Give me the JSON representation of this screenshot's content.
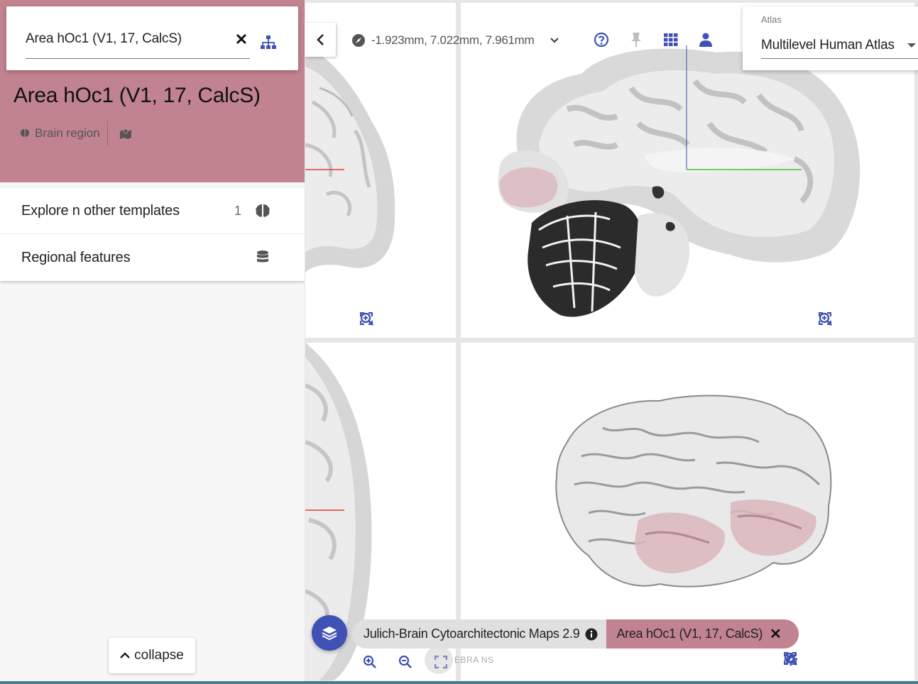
{
  "search": {
    "value": "Area hOc1 (V1, 17, CalcS)"
  },
  "region": {
    "title": "Area hOc1 (V1, 17, CalcS)",
    "type_label": "Brain region",
    "header_color": "#c0838f"
  },
  "list": {
    "explore_label": "Explore  n other templates",
    "explore_count": "1",
    "features_label": "Regional features"
  },
  "collapse_label": "collapse",
  "navigation": {
    "coordinates": "-1.923mm, 7.022mm, 7.961mm"
  },
  "atlas": {
    "label": "Atlas",
    "value": "Multilevel Human Atlas"
  },
  "layers": {
    "parcellation": "Julich-Brain Cytoarchitectonic Maps 2.9",
    "region": "Area hOc1 (V1, 17, CalcS)"
  },
  "watermark": "EBRA NS",
  "icons": {
    "search_clear": "close-icon",
    "hierarchy": "sitemap-icon",
    "brain": "brain-icon",
    "map": "map-marked-icon",
    "database": "database-icon",
    "compass": "compass-icon",
    "help": "question-circle-icon",
    "pin": "thumbtack-icon",
    "grid": "grid-icon",
    "user": "user-icon",
    "layers": "layers-icon",
    "settings": "gear-icon",
    "zoom_in": "zoom-in-icon",
    "zoom_out": "zoom-out-icon",
    "maximize": "maximize-icon"
  },
  "colors": {
    "accent": "#3f51b5",
    "region": "#c0838f"
  }
}
